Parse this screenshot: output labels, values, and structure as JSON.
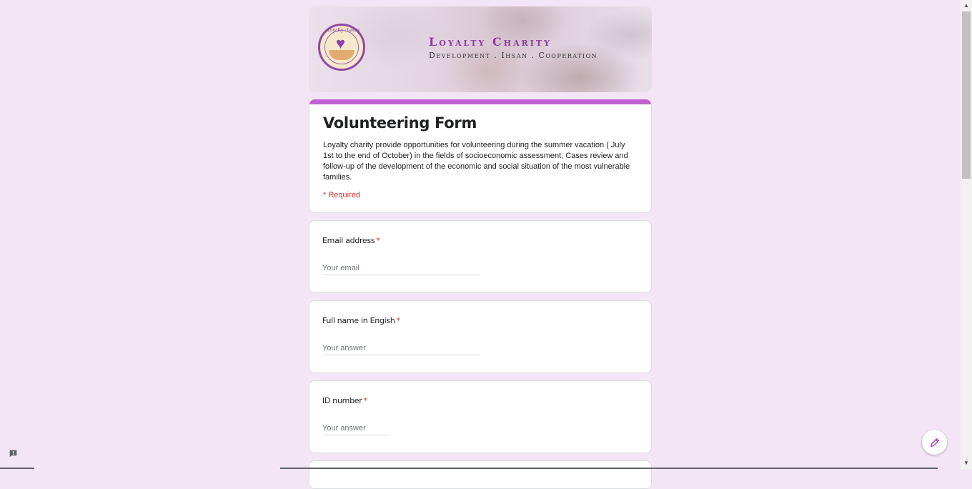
{
  "banner": {
    "org_name": "Loyalty Charity",
    "tagline": "Development . Ihsan . Cooperation",
    "logo_text": "Loyalty charity"
  },
  "form": {
    "title": "Volunteering Form",
    "description": "Loyalty charity provide opportunities for volunteering during the summer vacation ( July 1st to the end of October) in the fields of socioeconomic assessment, Cases review and follow-up of the development of the economic and social situation of the most vulnerable families.",
    "required_note": "* Required"
  },
  "questions": [
    {
      "label": "Email address",
      "required_mark": "*",
      "placeholder": "Your email"
    },
    {
      "label": "Full name in Engish",
      "required_mark": "*",
      "placeholder": "Your answer"
    },
    {
      "label": "ID number",
      "required_mark": "*",
      "placeholder": "Your answer"
    }
  ],
  "icons": {
    "edit": "pencil-icon",
    "report": "report-icon",
    "logo_heart": "heart-icon"
  },
  "colors": {
    "background": "#f4e5f6",
    "accent": "#c160d0",
    "required": "#d93025",
    "logo_purple": "#8f4aa2"
  }
}
